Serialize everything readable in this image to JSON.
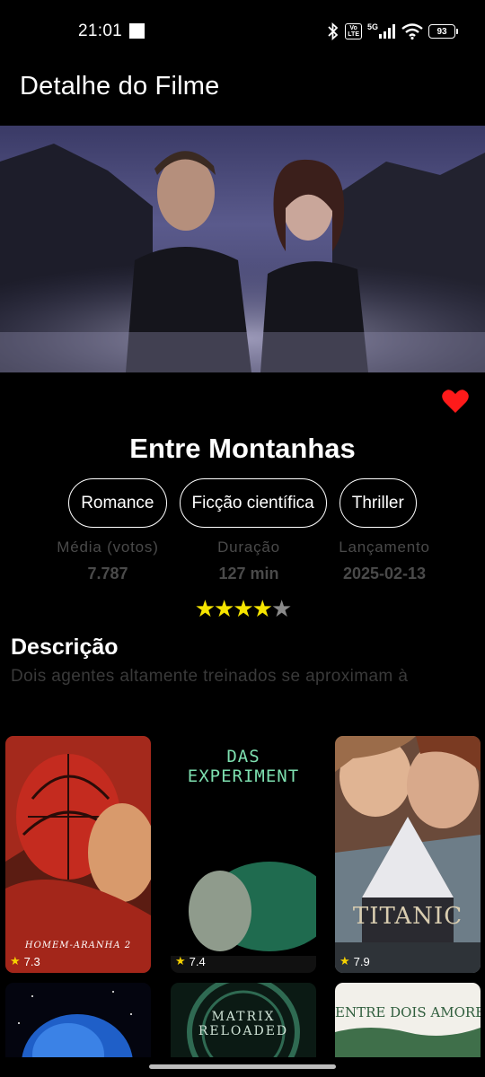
{
  "status_bar": {
    "time": "21:01",
    "volte": "Vo LTE",
    "network": "5G",
    "battery": "93"
  },
  "app_bar": {
    "title": "Detalhe do Filme"
  },
  "movie": {
    "title": "Entre Montanhas",
    "genres": [
      "Romance",
      "Ficção científica",
      "Thriller"
    ],
    "stats": [
      {
        "label": "Média (votos)",
        "value": "7.787"
      },
      {
        "label": "Duração",
        "value": "127 min"
      },
      {
        "label": "Lançamento",
        "value": "2025-02-13"
      }
    ],
    "rating_stars": {
      "filled": 4,
      "total": 5
    },
    "favorite": true,
    "favorite_color": "#ff1a1a"
  },
  "description": {
    "heading": "Descrição",
    "text": "Dois agentes altamente treinados se aproximam à"
  },
  "recommendations": [
    {
      "title": "HOMEM-ARANHA 2",
      "rating": "7.3"
    },
    {
      "title": "DAS EXPERIMENT",
      "rating": "7.4"
    },
    {
      "title": "TITANIC",
      "rating": "7.9"
    },
    {
      "title": "",
      "rating": ""
    },
    {
      "title": "MATRIX RELOADED",
      "rating": ""
    },
    {
      "title": "ENTRE DOIS AMORES",
      "rating": ""
    }
  ],
  "colors": {
    "background": "#000000",
    "star": "#f5e400",
    "muted_text": "#4a4a4a"
  }
}
